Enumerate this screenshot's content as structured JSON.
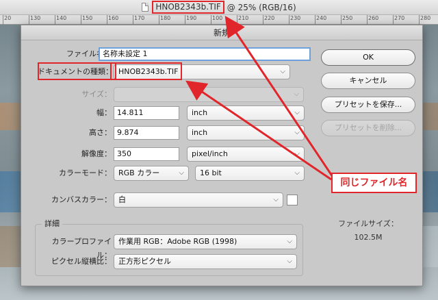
{
  "window": {
    "filename": "HNOB2343b.TIF",
    "zoom_mode": "@ 25% (RGB/16)"
  },
  "ruler": {
    "ticks": [
      "20",
      "130",
      "140",
      "150",
      "160",
      "170",
      "180",
      "190",
      "100",
      "210",
      "220",
      "230",
      "240",
      "250",
      "260",
      "270",
      "280"
    ]
  },
  "dialog": {
    "title": "新規",
    "name_label": "ファイル名：",
    "name_value": "名称未設定 1",
    "doctype_label": "ドキュメントの種類：",
    "doctype_value": "HNOB2343b.TIF",
    "size_label": "サイズ：",
    "width_label": "幅：",
    "width_value": "14.811",
    "width_unit": "inch",
    "height_label": "高さ：",
    "height_value": "9.874",
    "height_unit": "inch",
    "resolution_label": "解像度：",
    "resolution_value": "350",
    "resolution_unit": "pixel/inch",
    "colormode_label": "カラーモード：",
    "colormode_value": "RGB カラー",
    "bitdepth_value": "16 bit",
    "canvas_label": "カンバスカラー：",
    "canvas_value": "白",
    "advanced_label": "詳細",
    "profile_label": "カラープロファイル：",
    "profile_value": "作業用 RGB：Adobe RGB (1998)",
    "aspect_label": "ピクセル縦横比：",
    "aspect_value": "正方形ピクセル",
    "buttons": {
      "ok": "OK",
      "cancel": "キャンセル",
      "save_preset": "プリセットを保存...",
      "delete_preset": "プリセットを削除..."
    },
    "filesize_label": "ファイルサイズ：",
    "filesize_value": "102.5M"
  },
  "annotation": {
    "callout_text": "同じファイル名",
    "color": "#e0262a"
  }
}
